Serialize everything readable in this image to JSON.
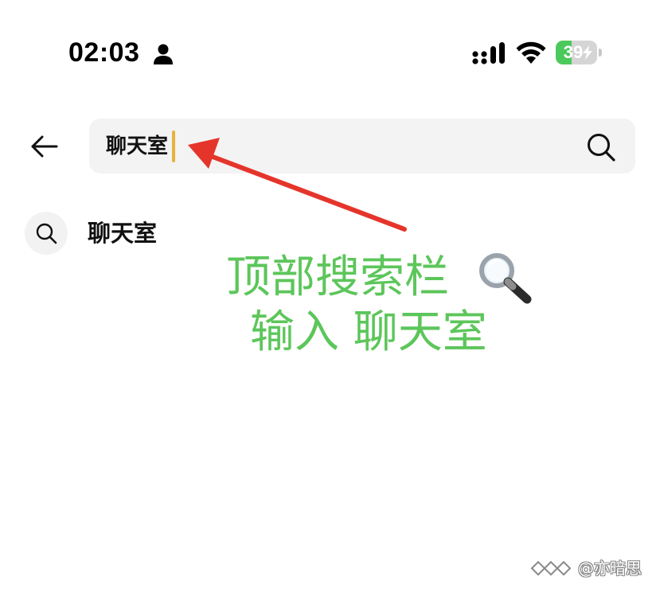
{
  "status_bar": {
    "time": "02:03",
    "person_icon": "person-fill-icon",
    "signal_icon": "cellular-signal-icon",
    "wifi_icon": "wifi-icon",
    "battery_level": "39",
    "battery_fraction": 0.39,
    "battery_color": "#4cc95b",
    "battery_icon": "charging-bolt-icon"
  },
  "search": {
    "back_icon": "arrow-left-icon",
    "value": "聊天室",
    "search_icon": "search-icon",
    "caret_color": "#e6b43e"
  },
  "suggestions": [
    {
      "icon": "search-icon",
      "label": "聊天室"
    }
  ],
  "annotation": {
    "line1": "顶部搜索栏",
    "line1_emoji": "magnifier-icon",
    "line2": "输入 聊天室",
    "text_color": "#5cc65a",
    "arrow_color": "#e5352b"
  },
  "watermark": {
    "text": "@亦暗思"
  }
}
